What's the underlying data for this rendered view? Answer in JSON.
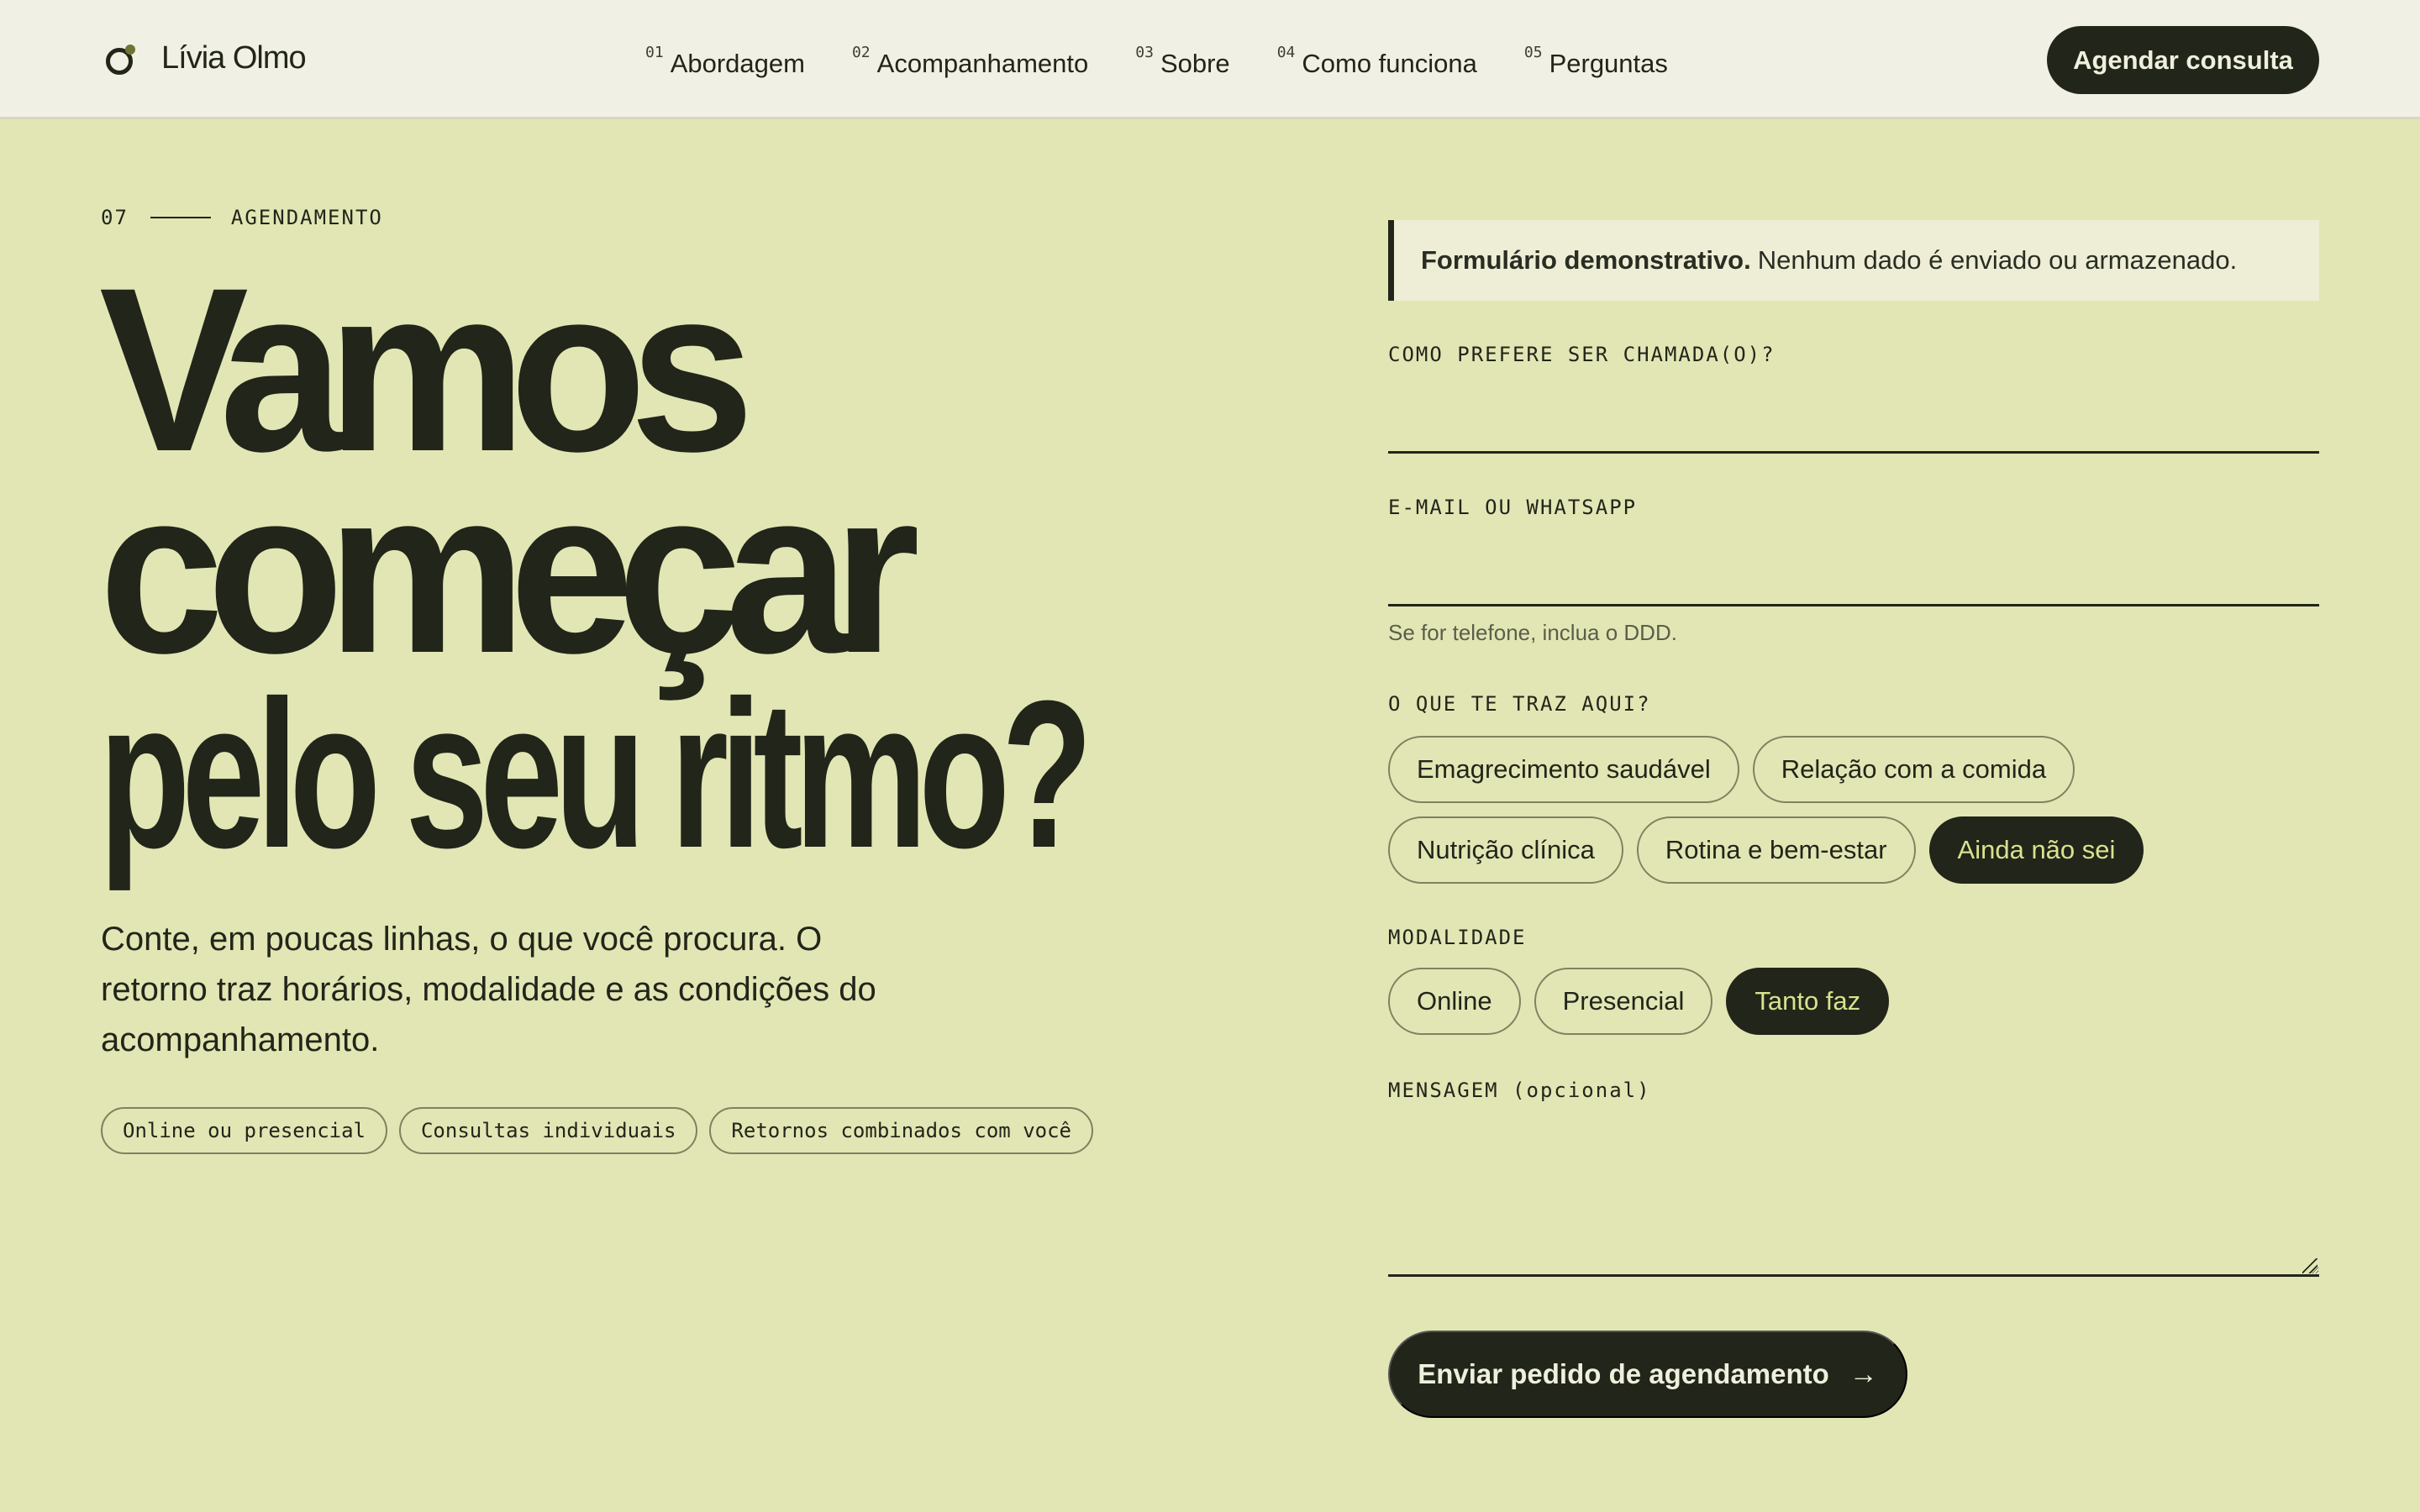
{
  "header": {
    "brand": "Lívia Olmo",
    "nav": [
      {
        "num": "01",
        "label": "Abordagem"
      },
      {
        "num": "02",
        "label": "Acompanhamento"
      },
      {
        "num": "03",
        "label": "Sobre"
      },
      {
        "num": "04",
        "label": "Como funciona"
      },
      {
        "num": "05",
        "label": "Perguntas"
      }
    ],
    "cta": "Agendar consulta"
  },
  "hero": {
    "section_num": "07",
    "section_label": "AGENDAMENTO",
    "title_line1": "Vamos",
    "title_line2": "começar",
    "title_line3": "pelo seu ritmo?",
    "subtitle": "Conte, em poucas linhas, o que você procura. O retorno traz horários, modalidade e as condições do acompanhamento.",
    "tags": [
      "Online ou presencial",
      "Consultas individuais",
      "Retornos combinados com você"
    ]
  },
  "form": {
    "notice_bold": "Formulário demonstrativo.",
    "notice_text": "Nenhum dado é enviado ou armazenado.",
    "name_label": "COMO PREFERE SER CHAMADA(O)?",
    "name_value": "",
    "contact_label": "E-MAIL OU WHATSAPP",
    "contact_value": "",
    "contact_hint": "Se for telefone, inclua o DDD.",
    "reason_label": "O QUE TE TRAZ AQUI?",
    "reasons": [
      "Emagrecimento saudável",
      "Relação com a comida",
      "Nutrição clínica",
      "Rotina e bem-estar",
      "Ainda não sei"
    ],
    "reason_selected": "Ainda não sei",
    "mode_label": "MODALIDADE",
    "modes": [
      "Online",
      "Presencial",
      "Tanto faz"
    ],
    "mode_selected": "Tanto faz",
    "message_label": "MENSAGEM (opcional)",
    "message_value": "",
    "submit_label": "Enviar pedido de agendamento",
    "submit_arrow": "→"
  },
  "colors": {
    "background": "#e2e6b4",
    "header_bg": "#f1f0e5",
    "ink": "#22251a",
    "accent_text": "#d9e28e"
  }
}
